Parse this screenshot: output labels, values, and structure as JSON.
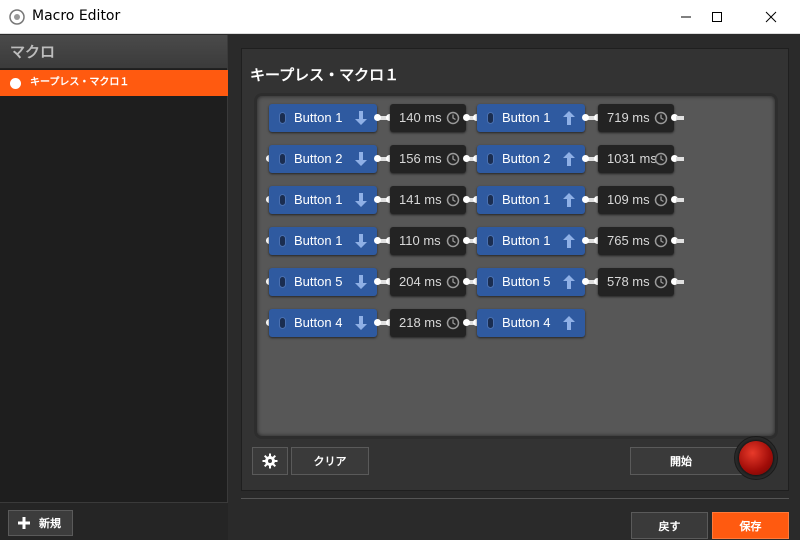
{
  "window": {
    "title": "Macro Editor"
  },
  "sidebar": {
    "header": "マクロ",
    "items": [
      {
        "label": "キープレス・マクロ１",
        "selected": true
      }
    ],
    "new_label": "新規"
  },
  "main": {
    "macro_title": "キープレス・マクロ１",
    "clear_label": "クリア",
    "start_label": "開始",
    "back_label": "戻す",
    "save_label": "保存"
  },
  "colors": {
    "accent": "#ff5a10",
    "button_block": "#2f5aa0",
    "delay_block": "#232323"
  },
  "macro_rows": [
    [
      {
        "type": "button",
        "label": "Button 1",
        "dir": "down"
      },
      {
        "type": "delay",
        "label": "140 ms"
      },
      {
        "type": "button",
        "label": "Button 1",
        "dir": "up"
      },
      {
        "type": "delay",
        "label": "719 ms"
      }
    ],
    [
      {
        "type": "button",
        "label": "Button 2",
        "dir": "down"
      },
      {
        "type": "delay",
        "label": "156 ms"
      },
      {
        "type": "button",
        "label": "Button 2",
        "dir": "up"
      },
      {
        "type": "delay",
        "label": "1031 ms"
      }
    ],
    [
      {
        "type": "button",
        "label": "Button 1",
        "dir": "down"
      },
      {
        "type": "delay",
        "label": "141 ms"
      },
      {
        "type": "button",
        "label": "Button 1",
        "dir": "up"
      },
      {
        "type": "delay",
        "label": "109 ms"
      }
    ],
    [
      {
        "type": "button",
        "label": "Button 1",
        "dir": "down"
      },
      {
        "type": "delay",
        "label": "110 ms"
      },
      {
        "type": "button",
        "label": "Button 1",
        "dir": "up"
      },
      {
        "type": "delay",
        "label": "765 ms"
      }
    ],
    [
      {
        "type": "button",
        "label": "Button 5",
        "dir": "down"
      },
      {
        "type": "delay",
        "label": "204 ms"
      },
      {
        "type": "button",
        "label": "Button 5",
        "dir": "up"
      },
      {
        "type": "delay",
        "label": "578 ms"
      }
    ],
    [
      {
        "type": "button",
        "label": "Button 4",
        "dir": "down"
      },
      {
        "type": "delay",
        "label": "218 ms"
      },
      {
        "type": "button",
        "label": "Button 4",
        "dir": "up"
      }
    ]
  ]
}
